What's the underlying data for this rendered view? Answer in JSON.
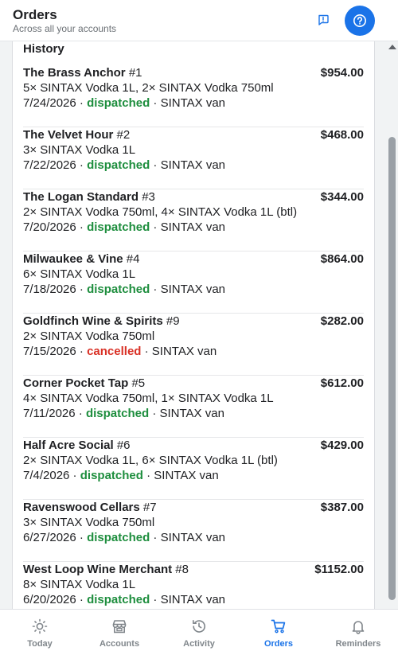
{
  "header": {
    "title": "Orders",
    "subtitle": "Across all your accounts"
  },
  "section_title": "History",
  "orders": [
    {
      "account": "The Brass Anchor",
      "number": "#1",
      "amount": "$954.00",
      "items": "5× SINTAX Vodka 1L, 2× SINTAX Vodka 750ml",
      "date": "7/24/2026",
      "status": "dispatched",
      "carrier": "SINTAX van"
    },
    {
      "account": "The Velvet Hour",
      "number": "#2",
      "amount": "$468.00",
      "items": "3× SINTAX Vodka 1L",
      "date": "7/22/2026",
      "status": "dispatched",
      "carrier": "SINTAX van"
    },
    {
      "account": "The Logan Standard",
      "number": "#3",
      "amount": "$344.00",
      "items": "2× SINTAX Vodka 750ml, 4× SINTAX Vodka 1L (btl)",
      "date": "7/20/2026",
      "status": "dispatched",
      "carrier": "SINTAX van"
    },
    {
      "account": "Milwaukee & Vine",
      "number": "#4",
      "amount": "$864.00",
      "items": "6× SINTAX Vodka 1L",
      "date": "7/18/2026",
      "status": "dispatched",
      "carrier": "SINTAX van"
    },
    {
      "account": "Goldfinch Wine & Spirits",
      "number": "#9",
      "amount": "$282.00",
      "items": "2× SINTAX Vodka 750ml",
      "date": "7/15/2026",
      "status": "cancelled",
      "carrier": "SINTAX van"
    },
    {
      "account": "Corner Pocket Tap",
      "number": "#5",
      "amount": "$612.00",
      "items": "4× SINTAX Vodka 750ml, 1× SINTAX Vodka 1L",
      "date": "7/11/2026",
      "status": "dispatched",
      "carrier": "SINTAX van"
    },
    {
      "account": "Half Acre Social",
      "number": "#6",
      "amount": "$429.00",
      "items": "2× SINTAX Vodka 1L, 6× SINTAX Vodka 1L (btl)",
      "date": "7/4/2026",
      "status": "dispatched",
      "carrier": "SINTAX van"
    },
    {
      "account": "Ravenswood Cellars",
      "number": "#7",
      "amount": "$387.00",
      "items": "3× SINTAX Vodka 750ml",
      "date": "6/27/2026",
      "status": "dispatched",
      "carrier": "SINTAX van"
    },
    {
      "account": "West Loop Wine Merchant",
      "number": "#8",
      "amount": "$1152.00",
      "items": "8× SINTAX Vodka 1L",
      "date": "6/20/2026",
      "status": "dispatched",
      "carrier": "SINTAX van"
    }
  ],
  "tabs": [
    {
      "label": "Today",
      "icon": "sun-icon",
      "active": false
    },
    {
      "label": "Accounts",
      "icon": "store-icon",
      "active": false
    },
    {
      "label": "Activity",
      "icon": "history-icon",
      "active": false
    },
    {
      "label": "Orders",
      "icon": "cart-icon",
      "active": true
    },
    {
      "label": "Reminders",
      "icon": "bell-icon",
      "active": false
    }
  ],
  "colors": {
    "accent": "#1a73e8",
    "dispatched": "#1e8e3e",
    "cancelled": "#d93025",
    "inactive_tab": "#80868b"
  }
}
